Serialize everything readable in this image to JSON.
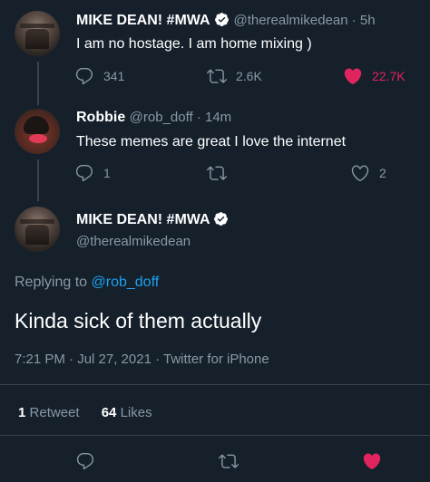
{
  "tweet1": {
    "name": "MIKE DEAN! #MWA",
    "handle": "@therealmikedean · 5h",
    "text": "I am no hostage. I am home mixing )",
    "replies": "341",
    "retweets": "2.6K",
    "likes": "22.7K"
  },
  "tweet2": {
    "name": "Robbie",
    "handle": "@rob_doff · 14m",
    "text": "These memes are great I love the internet",
    "replies": "1",
    "likes": "2"
  },
  "main": {
    "name": "MIKE DEAN! #MWA",
    "handle": "@therealmikedean",
    "replying_prefix": "Replying to",
    "replying_handle": "@rob_doff",
    "text": "Kinda sick of them actually",
    "meta": "7:21 PM · Jul 27, 2021 · Twitter for iPhone",
    "retweet_count": "1",
    "retweet_label": "Retweet",
    "like_count": "64",
    "like_label": "Likes"
  },
  "colors": {
    "background": "#15202b",
    "secondary_text": "#8899a6",
    "link": "#1da1f2",
    "like": "#e0245e",
    "divider": "#38444d"
  }
}
